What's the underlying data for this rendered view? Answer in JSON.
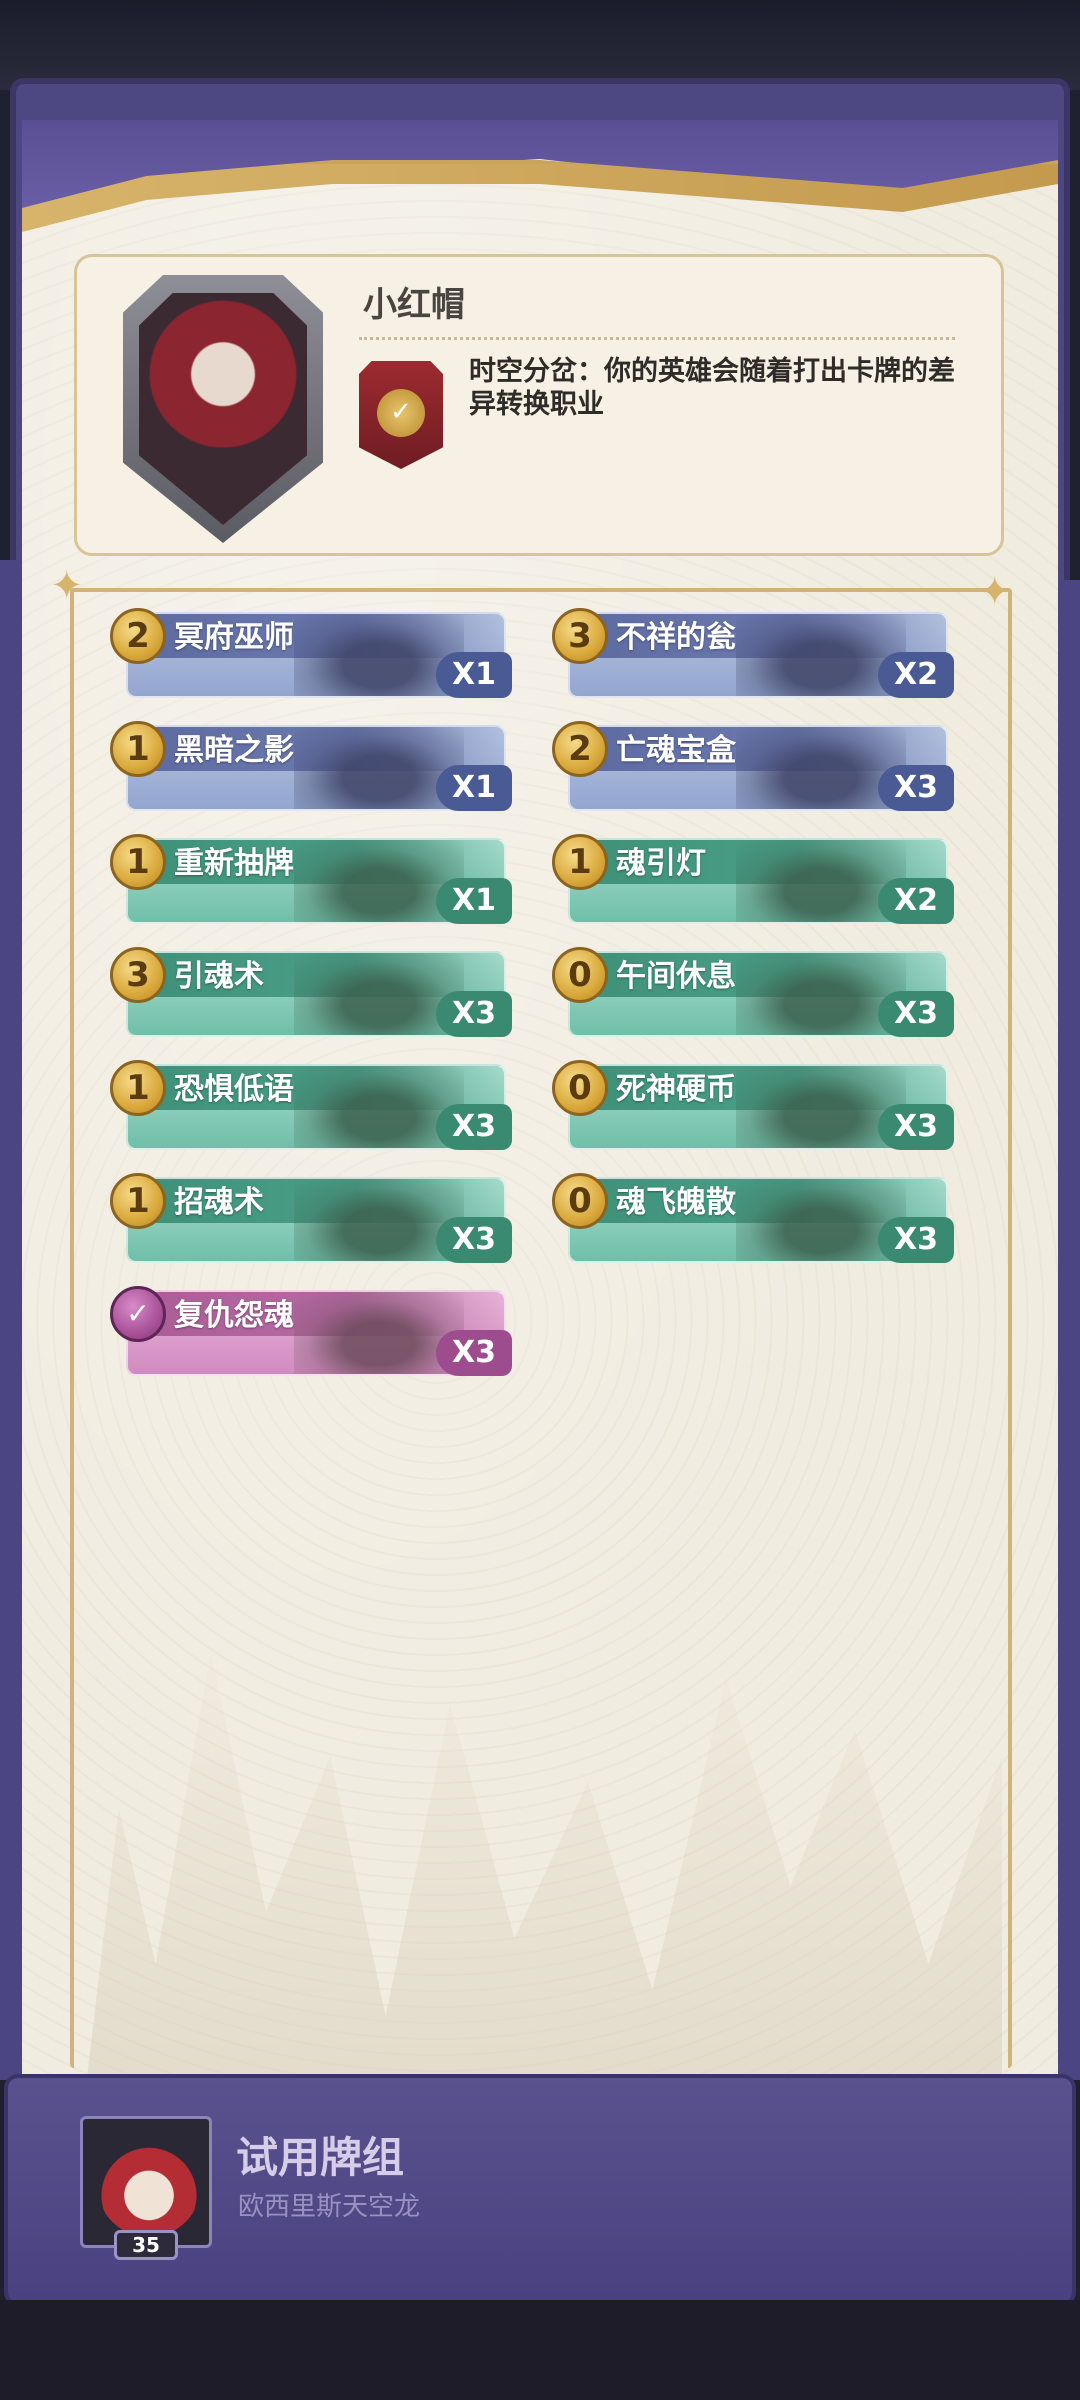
{
  "hero": {
    "name": "小红帽",
    "skill_text": "时空分岔：你的英雄会随着打出卡牌的差异转换职业",
    "skill_icon": "check"
  },
  "cards": [
    {
      "cost": "2",
      "name": "冥府巫师",
      "count": "X1",
      "color": "blue"
    },
    {
      "cost": "3",
      "name": "不祥的瓮",
      "count": "X2",
      "color": "blue"
    },
    {
      "cost": "1",
      "name": "黑暗之影",
      "count": "X1",
      "color": "blue"
    },
    {
      "cost": "2",
      "name": "亡魂宝盒",
      "count": "X3",
      "color": "blue"
    },
    {
      "cost": "1",
      "name": "重新抽牌",
      "count": "X1",
      "color": "green"
    },
    {
      "cost": "1",
      "name": "魂引灯",
      "count": "X2",
      "color": "green"
    },
    {
      "cost": "3",
      "name": "引魂术",
      "count": "X3",
      "color": "green"
    },
    {
      "cost": "0",
      "name": "午间休息",
      "count": "X3",
      "color": "green"
    },
    {
      "cost": "1",
      "name": "恐惧低语",
      "count": "X3",
      "color": "green"
    },
    {
      "cost": "0",
      "name": "死神硬币",
      "count": "X3",
      "color": "green"
    },
    {
      "cost": "1",
      "name": "招魂术",
      "count": "X3",
      "color": "green"
    },
    {
      "cost": "0",
      "name": "魂飞魄散",
      "count": "X3",
      "color": "green"
    },
    {
      "cost": "✓",
      "name": "复仇怨魂",
      "count": "X3",
      "color": "pink"
    }
  ],
  "deck": {
    "title": "试用牌组",
    "subtitle": "欧西里斯天空龙",
    "card_count": "35"
  },
  "colors": {
    "frame_purple": "#4d4782",
    "paper": "#f0eadc",
    "gold": "#d7b46b",
    "attack_blue": "#5c6aa0",
    "skill_green": "#3e8f78",
    "special_pink": "#a95c96"
  }
}
